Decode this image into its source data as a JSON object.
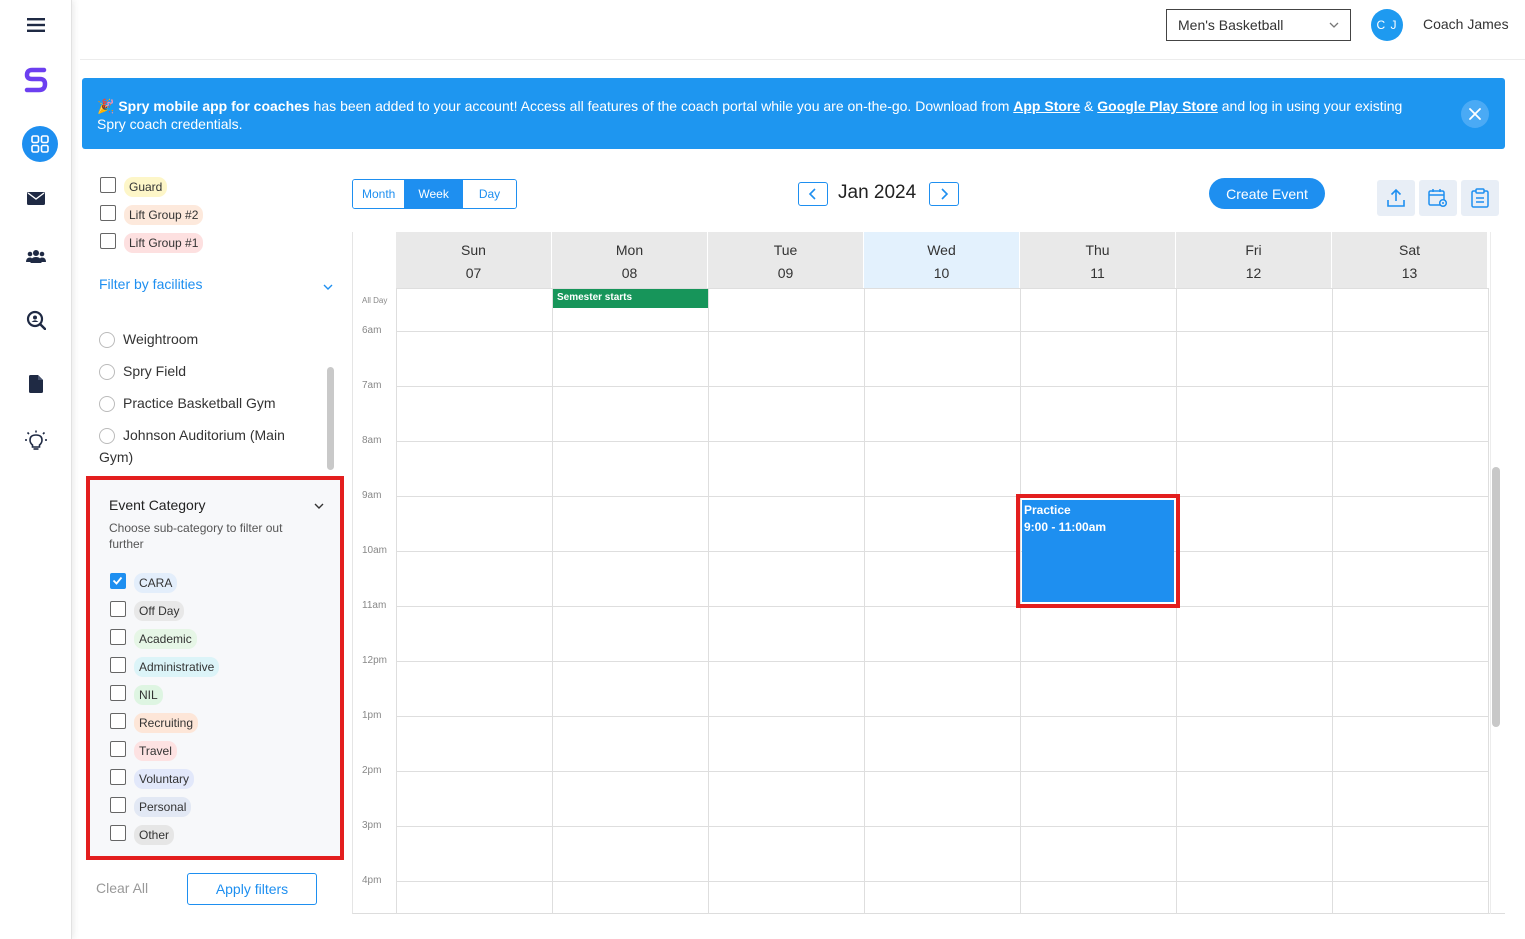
{
  "topbar": {
    "team": "Men's Basketball",
    "avatar_initials": "C J",
    "user_name": "Coach James"
  },
  "banner": {
    "emoji": "🎉",
    "bold_lead": "Spry mobile app for coaches",
    "text1": " has been added to your account! Access all features of the coach portal while you are on-the-go. Download from ",
    "app_store": "App Store",
    "amp": " & ",
    "play_store": "Google Play Store",
    "text2": " and log in using your existing Spry coach credentials."
  },
  "groups": [
    {
      "label": "Guard",
      "color": "#fdf6c8"
    },
    {
      "label": "Lift Group #2",
      "color": "#fde9dc"
    },
    {
      "label": "Lift Group #1",
      "color": "#fde0e0"
    }
  ],
  "facilities": {
    "header": "Filter by facilities",
    "items": [
      "Weightroom",
      "Spry Field",
      "Practice Basketball Gym",
      "Johnson Auditorium (Main",
      "Gym)"
    ]
  },
  "event_category": {
    "title": "Event Category",
    "subtitle": "Choose sub-category to filter out further",
    "items": [
      {
        "label": "CARA",
        "checked": true,
        "color": "#e3eefb"
      },
      {
        "label": "Off Day",
        "checked": false,
        "color": "#e8e8e8"
      },
      {
        "label": "Academic",
        "checked": false,
        "color": "#e6f6e6"
      },
      {
        "label": "Administrative",
        "checked": false,
        "color": "#dcf4f8"
      },
      {
        "label": "NIL",
        "checked": false,
        "color": "#def5e2"
      },
      {
        "label": "Recruiting",
        "checked": false,
        "color": "#fde6d8"
      },
      {
        "label": "Travel",
        "checked": false,
        "color": "#fde2e2"
      },
      {
        "label": "Voluntary",
        "checked": false,
        "color": "#e2e8fa"
      },
      {
        "label": "Personal",
        "checked": false,
        "color": "#e2e8f4"
      },
      {
        "label": "Other",
        "checked": false,
        "color": "#e6e6e6"
      }
    ]
  },
  "footer": {
    "clear_all": "Clear All",
    "apply": "Apply filters"
  },
  "calendar": {
    "views": [
      "Month",
      "Week",
      "Day"
    ],
    "active_view": "Week",
    "title": "Jan 2024",
    "create_event": "Create Event",
    "all_day_label": "All Day",
    "days": [
      {
        "name": "Sun",
        "date": "07"
      },
      {
        "name": "Mon",
        "date": "08"
      },
      {
        "name": "Tue",
        "date": "09"
      },
      {
        "name": "Wed",
        "date": "10",
        "today": true
      },
      {
        "name": "Thu",
        "date": "11"
      },
      {
        "name": "Fri",
        "date": "12"
      },
      {
        "name": "Sat",
        "date": "13"
      }
    ],
    "times": [
      "6am",
      "7am",
      "8am",
      "9am",
      "10am",
      "11am",
      "12pm",
      "1pm",
      "2pm",
      "3pm",
      "4pm"
    ],
    "events": {
      "semester": "Semester starts",
      "practice_title": "Practice",
      "practice_time": "9:00 - 11:00am"
    }
  },
  "colors": {
    "accent": "#1e8ff0",
    "highlight": "#e31e1e",
    "event_green": "#17955a"
  }
}
